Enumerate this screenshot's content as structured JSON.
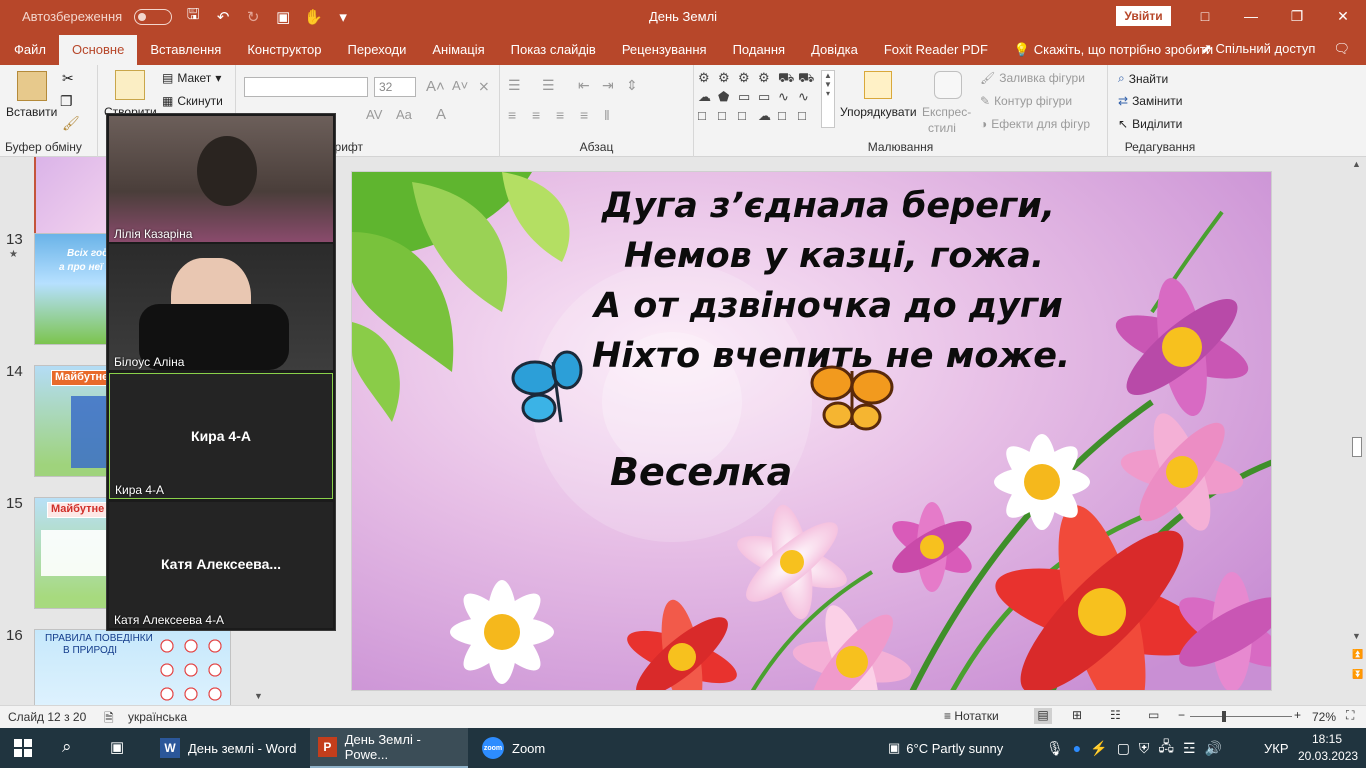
{
  "titlebar": {
    "autosave_label": "Автозбереження",
    "doc_title": "День Землі",
    "signin_label": "Увійти",
    "colors": {
      "accent": "#b7472a"
    }
  },
  "tabs": {
    "items": [
      "Файл",
      "Основне",
      "Вставлення",
      "Конструктор",
      "Переходи",
      "Анімація",
      "Показ слайдів",
      "Рецензування",
      "Подання",
      "Довідка",
      "Foxit Reader PDF"
    ],
    "active": "Основне",
    "tell_me": "Скажіть, що потрібно зробити",
    "share": "Спільний доступ"
  },
  "ribbon": {
    "clipboard": {
      "paste": "Вставити",
      "label": "Буфер обміну"
    },
    "slides": {
      "new_slide": "Створити",
      "layout": "Макет",
      "reset": "Скинути"
    },
    "font": {
      "size": "32",
      "label": "Шрифт"
    },
    "paragraph": {
      "label": "Абзац"
    },
    "drawing": {
      "arrange": "Упорядкувати",
      "quick_styles_1": "Експрес-",
      "quick_styles_2": "стилі",
      "fill": "Заливка фігури",
      "outline": "Контур фігури",
      "effects": "Ефекти для фігур",
      "label": "Малювання"
    },
    "editing": {
      "find": "Знайти",
      "replace": "Замінити",
      "select": "Виділити",
      "label": "Редагування"
    }
  },
  "thumbnails": [
    {
      "num": "13",
      "text_1": "Всіх году...",
      "text_2": "а про неї н..."
    },
    {
      "num": "14",
      "title": "Майбутне..."
    },
    {
      "num": "15",
      "title": "Майбутне"
    },
    {
      "num": "16",
      "title_1": "ПРАВИЛА ПОВЕДІНКИ",
      "title_2": "В ПРИРОДІ"
    }
  ],
  "slide": {
    "lines": [
      "Дуга з’єднала береги,",
      "Немов у казці, гожа.",
      "А от дзвіночка до дуги",
      "Ніхто вчепить не може."
    ],
    "answer": "Веселка"
  },
  "zoom_participants": [
    {
      "name": "Лілія Казаріна",
      "video": true
    },
    {
      "name": "Білоус Аліна",
      "video": true
    },
    {
      "name": "Кира 4-А",
      "video": false,
      "display": "Кира 4-А",
      "active": true
    },
    {
      "name": "Катя Алексеева 4-А",
      "video": false,
      "display": "Катя  Алексеева..."
    }
  ],
  "status": {
    "slide_counter": "Слайд 12 з 20",
    "language": "українська",
    "notes": "Нотатки",
    "zoom_level": "72%"
  },
  "taskbar": {
    "apps": [
      {
        "label": "День землі - Word",
        "badge": "W",
        "color": "#2b579a"
      },
      {
        "label": "День Землі - Powe...",
        "badge": "P",
        "color": "#c43e1c",
        "active": true
      },
      {
        "label": "Zoom",
        "badge": "zoom",
        "color": "#2d8cff"
      }
    ],
    "weather": "6°C  Partly sunny",
    "lang": "УКР",
    "time": "18:15",
    "date": "20.03.2023"
  }
}
